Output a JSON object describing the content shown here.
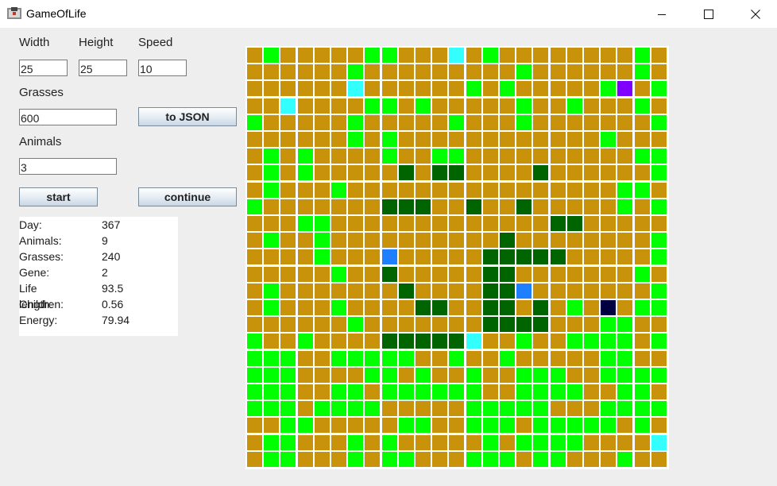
{
  "window": {
    "title": "GameOfLife",
    "controls": [
      "minimize",
      "maximize",
      "close"
    ]
  },
  "settings": {
    "width_label": "Width",
    "width_value": "25",
    "height_label": "Height",
    "height_value": "25",
    "speed_label": "Speed",
    "speed_value": "10",
    "grasses_label": "Grasses",
    "grasses_value": "600",
    "animals_label": "Animals",
    "animals_value": "3"
  },
  "buttons": {
    "to_json": "to JSON",
    "start": "start",
    "continue": "continue"
  },
  "stats": [
    {
      "label": "Day:",
      "value": "367"
    },
    {
      "label": "Animals:",
      "value": "9"
    },
    {
      "label": "Grasses:",
      "value": "240"
    },
    {
      "label": "Gene:",
      "value": "2"
    },
    {
      "label": "Life length:",
      "value": "93.5"
    },
    {
      "label": "Children:",
      "value": "0.56"
    },
    {
      "label": "Energy:",
      "value": "79.94"
    }
  ],
  "board": {
    "columns": 25,
    "rows": 25,
    "legend": {
      "S": {
        "name": "soil",
        "color": "#c8920a"
      },
      "G": {
        "name": "grass",
        "color": "#00ff00"
      },
      "J": {
        "name": "jungle",
        "color": "#006400"
      },
      "C": {
        "name": "animal-cyan",
        "color": "#33ffff"
      },
      "B": {
        "name": "animal-blue",
        "color": "#1e7fff"
      },
      "P": {
        "name": "animal-purple",
        "color": "#8000ff"
      },
      "N": {
        "name": "animal-navy",
        "color": "#000040"
      }
    },
    "cells": [
      "SGSSSSSGGSSSCSGSSSSSSSSGS",
      "SSSSSSGSSSSSSSSSGSSSSSSGS",
      "SSSSSSCSSSSSSGSGSSSSSGPSG",
      "SSCSSSSGGSGSSSSSGSSGSSSGS",
      "GSSSSSGSSSSSGSSSGSSSSSSSG",
      "SSSSSSGSGSSSSSSSSSSSSGSSS",
      "SGSGSSSSGSSGGSSSSSSSSSSGG",
      "SGSGSSSSSJSJJSSSSJSSSSSSG",
      "SGSSSGSSSSSSSSSSSSSSSSGGS",
      "GSSSSSSSJJJSSJSSJSSSSSGSG",
      "SSSGGSSSSSSSSSSSSSJJSSSSS",
      "SGSSGSSSSSSSSSSJSSSSSSSSG",
      "SSSSGSSSBSSSSSJJJJJSSSSSG",
      "SSSSSGSSJSSSSSJJSSSSSSSGS",
      "SGSSSSSSSJSSSSJJBSSSSSSSG",
      "SGSSSGSSSSJJSSJJSJSGSNSGG",
      "SSSSSSGSSSSSSSJJJJSSSGGSS",
      "GSSGSSSSJJJJJCSSGSSGGGGSG",
      "GGGSSGGGGGSSGSSGSSSSSGGSS",
      "GGGSSSSGGSGSSGSSGGGSSGGGG",
      "GGGSSGGSGGGGGGSSGGGGSSGGS",
      "GGGSGGGGSSSSSGGGGGSSSGGGG",
      "SSGGSSSSSGGSSGGGSGGGGGSGS",
      "SGGSSSGSGSSSSSGSGGGGSSSSC",
      "SGGSSSGSGGSSSGGGSGGSSSGSS"
    ]
  }
}
